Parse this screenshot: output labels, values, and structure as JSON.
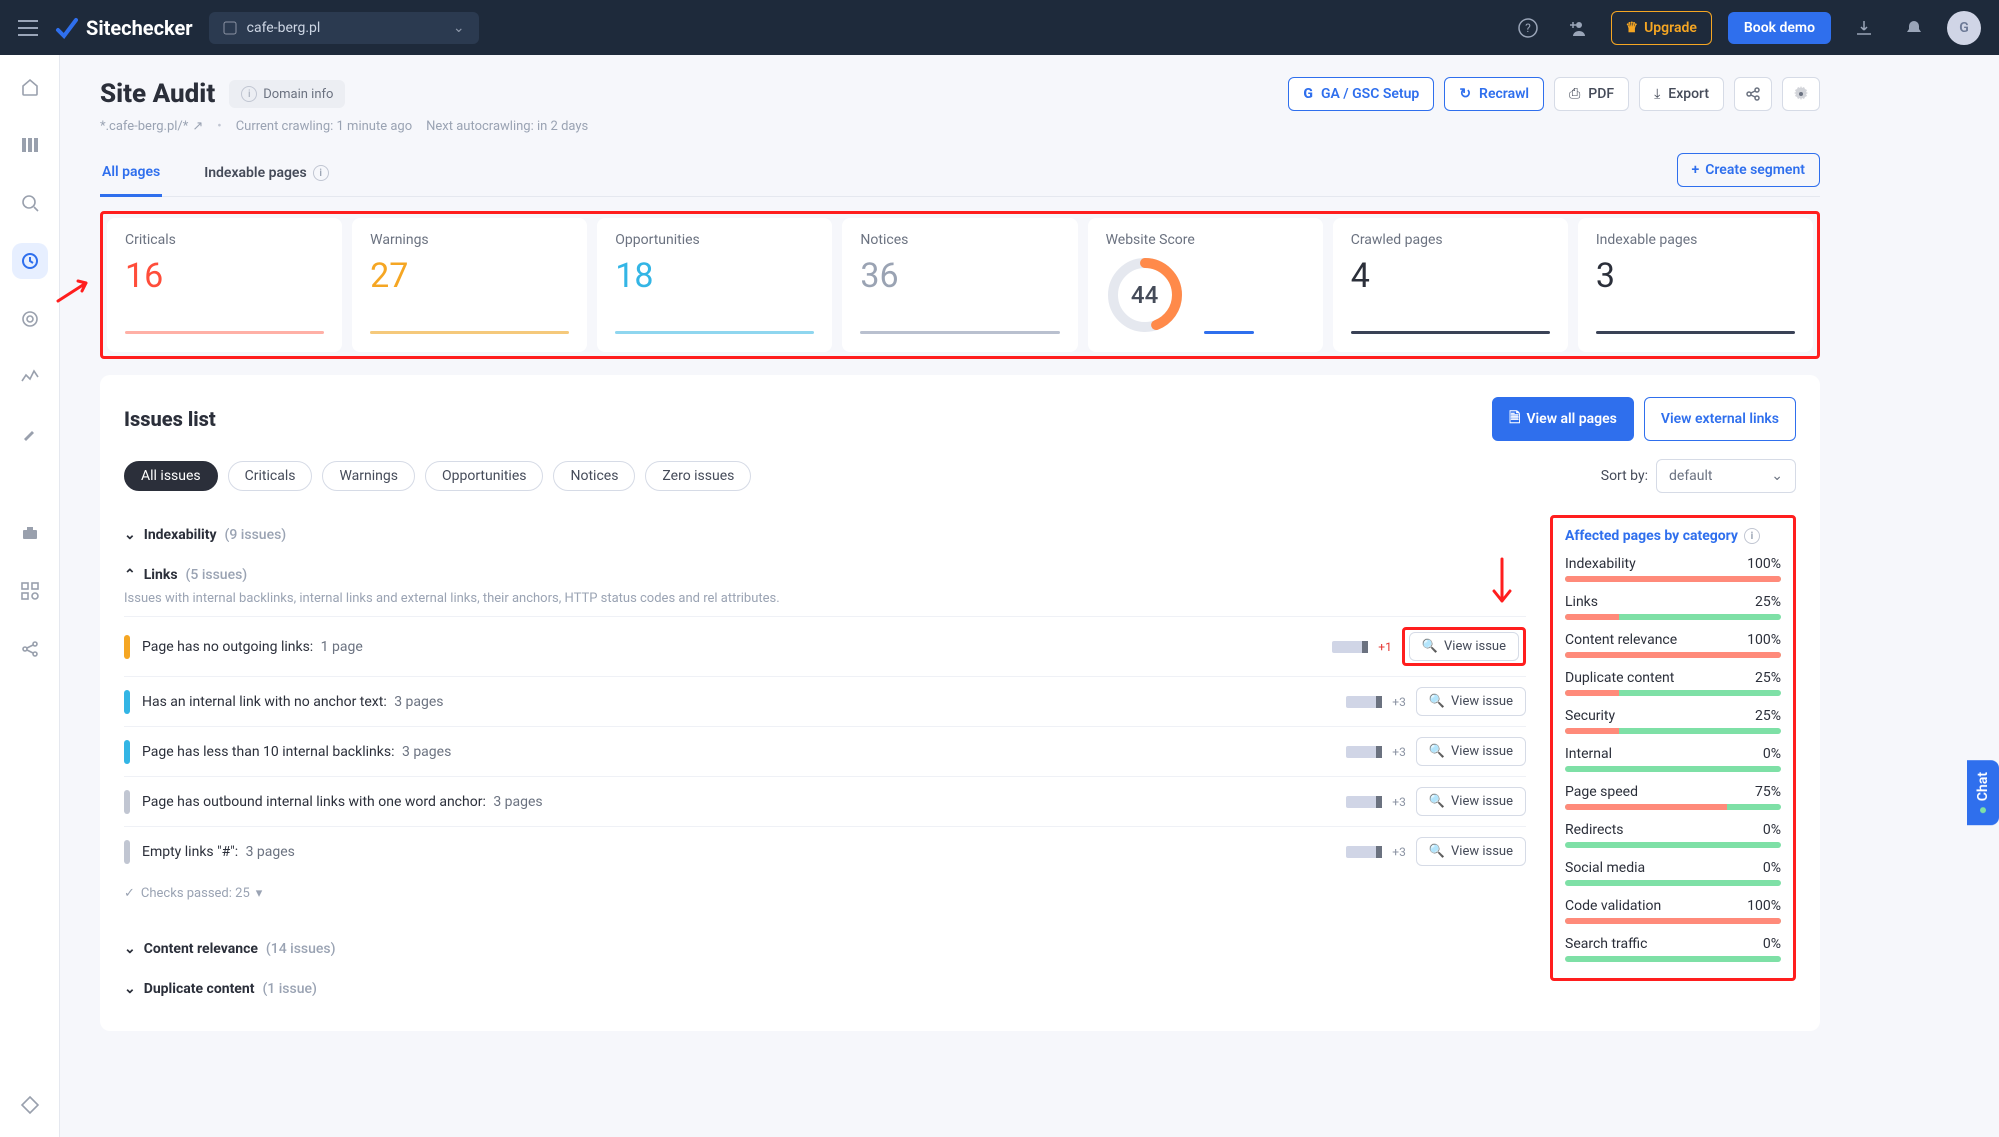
{
  "top": {
    "brand": "Sitechecker",
    "site": "cafe-berg.pl",
    "upgrade": "Upgrade",
    "demo": "Book demo",
    "avatar_letter": "G"
  },
  "header": {
    "title": "Site Audit",
    "domain_info": "Domain info",
    "path": "*.cafe-berg.pl/*",
    "crawling": "Current crawling: 1 minute ago",
    "next": "Next autocrawling: in 2 days",
    "ga": "GA / GSC Setup",
    "recrawl": "Recrawl",
    "pdf": "PDF",
    "export": "Export"
  },
  "tabs": {
    "all": "All pages",
    "indexable": "Indexable pages",
    "create": "Create segment"
  },
  "cards": {
    "criticals_label": "Criticals",
    "criticals": "16",
    "warnings_label": "Warnings",
    "warnings": "27",
    "opps_label": "Opportunities",
    "opps": "18",
    "notices_label": "Notices",
    "notices": "36",
    "score_label": "Website Score",
    "score": "44",
    "crawled_label": "Crawled pages",
    "crawled": "4",
    "indexable_label": "Indexable pages",
    "indexable": "3"
  },
  "issues": {
    "title": "Issues list",
    "view_all": "View all pages",
    "view_ext": "View external links",
    "filters": {
      "all": "All issues",
      "crit": "Criticals",
      "warn": "Warnings",
      "opp": "Opportunities",
      "not": "Notices",
      "zero": "Zero issues"
    },
    "sort_label": "Sort by:",
    "sort_value": "default",
    "view_issue": "View issue",
    "checks_passed": "Checks passed: 25"
  },
  "cats": {
    "indexability": {
      "title": "Indexability",
      "count": "(9 issues)"
    },
    "links": {
      "title": "Links",
      "count": "(5 issues)",
      "desc": "Issues with internal backlinks, internal links and external links, their anchors, HTTP status codes and rel attributes.",
      "rows": [
        {
          "t": "Page has no outgoing links:",
          "p": "1 page",
          "d": "+1",
          "dc": "red",
          "sev": "orange"
        },
        {
          "t": "Has an internal link with no anchor text:",
          "p": "3 pages",
          "d": "+3",
          "dc": "gray",
          "sev": "blue"
        },
        {
          "t": "Page has less than 10 internal backlinks:",
          "p": "3 pages",
          "d": "+3",
          "dc": "gray",
          "sev": "blue"
        },
        {
          "t": "Page has outbound internal links with one word anchor:",
          "p": "3 pages",
          "d": "+3",
          "dc": "gray",
          "sev": "gray"
        },
        {
          "t": "Empty links \"#\":",
          "p": "3 pages",
          "d": "+3",
          "dc": "gray",
          "sev": "gray"
        }
      ]
    },
    "content": {
      "title": "Content relevance",
      "count": "(14 issues)"
    },
    "dup": {
      "title": "Duplicate content",
      "count": "(1 issue)"
    }
  },
  "affected": {
    "title": "Affected pages by category",
    "rows": [
      {
        "label": "Indexability",
        "pct": "100%",
        "v": 100
      },
      {
        "label": "Links",
        "pct": "25%",
        "v": 25
      },
      {
        "label": "Content relevance",
        "pct": "100%",
        "v": 100
      },
      {
        "label": "Duplicate content",
        "pct": "25%",
        "v": 25
      },
      {
        "label": "Security",
        "pct": "25%",
        "v": 25
      },
      {
        "label": "Internal",
        "pct": "0%",
        "v": 0
      },
      {
        "label": "Page speed",
        "pct": "75%",
        "v": 75
      },
      {
        "label": "Redirects",
        "pct": "0%",
        "v": 0
      },
      {
        "label": "Social media",
        "pct": "0%",
        "v": 0
      },
      {
        "label": "Code validation",
        "pct": "100%",
        "v": 100
      },
      {
        "label": "Search traffic",
        "pct": "0%",
        "v": 0
      }
    ]
  },
  "chat": "Chat"
}
